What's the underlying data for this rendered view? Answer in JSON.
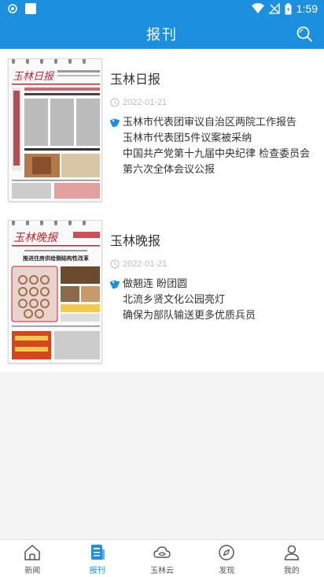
{
  "status": {
    "time": "1:59"
  },
  "header": {
    "title": "报刊"
  },
  "papers": [
    {
      "name": "玉林日报",
      "masthead": "玉林日报",
      "date": "2022-01-21",
      "headlines": [
        "玉林市代表团审议自治区两院工作报告",
        "玉林市代表团5件议案被采纳",
        "中国共产党第十九届中央纪律 检查委员会第六次全体会议公报"
      ]
    },
    {
      "name": "玉林晚报",
      "masthead": "玉林晚报",
      "cover_headline": "推进住房供给侧结构性改革",
      "date": "2022-01-21",
      "headlines": [
        "做翘连 盼团圆",
        "北流乡贤文化公园亮灯",
        "确保为部队输送更多优质兵员"
      ]
    }
  ],
  "bottom_nav": [
    {
      "label": "新闻",
      "icon": "home-icon"
    },
    {
      "label": "报刊",
      "icon": "newspaper-icon",
      "active": true
    },
    {
      "label": "玉林云",
      "icon": "cloud-icon"
    },
    {
      "label": "发现",
      "icon": "compass-icon"
    },
    {
      "label": "我的",
      "icon": "user-icon"
    }
  ]
}
